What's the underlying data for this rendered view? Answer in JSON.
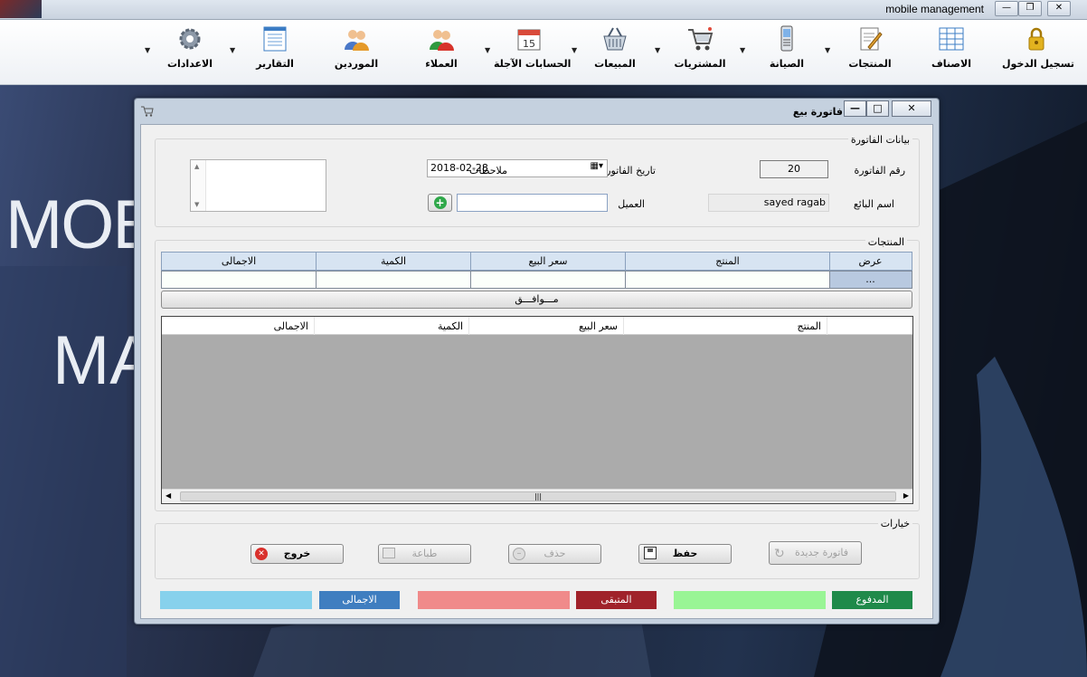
{
  "app": {
    "title": "mobile management"
  },
  "toolbar": {
    "items": [
      {
        "label": "تسجيل الدخول",
        "icon": "lock-icon"
      },
      {
        "label": "الاصناف",
        "icon": "grid-table-icon"
      },
      {
        "label": "المنتجات",
        "icon": "edit-document-icon"
      },
      {
        "label": "الصيانة",
        "icon": "mobile-phone-icon"
      },
      {
        "label": "المشتريات",
        "icon": "shopping-cart-icon"
      },
      {
        "label": "المبيعات",
        "icon": "basket-icon"
      },
      {
        "label": "الحسابات الآجلة",
        "icon": "calendar-icon"
      },
      {
        "label": "العملاء",
        "icon": "customers-icon"
      },
      {
        "label": "الموردين",
        "icon": "suppliers-icon"
      },
      {
        "label": "التقارير",
        "icon": "report-icon"
      },
      {
        "label": "الاعدادات",
        "icon": "settings-gear-icon"
      }
    ]
  },
  "background": {
    "line1": "MOB",
    "line2": "MA"
  },
  "window": {
    "title": "فاتورة بيع",
    "invoice_group": {
      "title": "بيانات الفاتورة",
      "invoice_no_label": "رقم الفاتورة",
      "invoice_no": "20",
      "date_label": "تاريخ الفاتورة",
      "date": "2018-02-28",
      "notes_label": "ملاحظات",
      "seller_label": "اسم البائع",
      "seller": "sayed ragab",
      "customer_label": "العميل",
      "customer": ""
    },
    "products_group": {
      "title": "المنتجات",
      "entry_headers": [
        "عرض",
        "المنتج",
        "سعر البيع",
        "الكمية",
        "الاجمالى"
      ],
      "show_button": "...",
      "ok_button": "مـــوافـــق",
      "list_headers": [
        "المنتج",
        "سعر البيع",
        "الكمية",
        "الاجمالى"
      ]
    },
    "options_group": {
      "title": "خيارات",
      "new_invoice": "فاتورة جديدة",
      "save": "حفظ",
      "delete": "حذف",
      "print": "طباعة",
      "exit": "خروج"
    },
    "summary": {
      "paid_label": "المدفوع",
      "paid_value": "",
      "remaining_label": "المتبقى",
      "remaining_value": "",
      "total_label": "الاجمالى",
      "total_value": ""
    }
  }
}
